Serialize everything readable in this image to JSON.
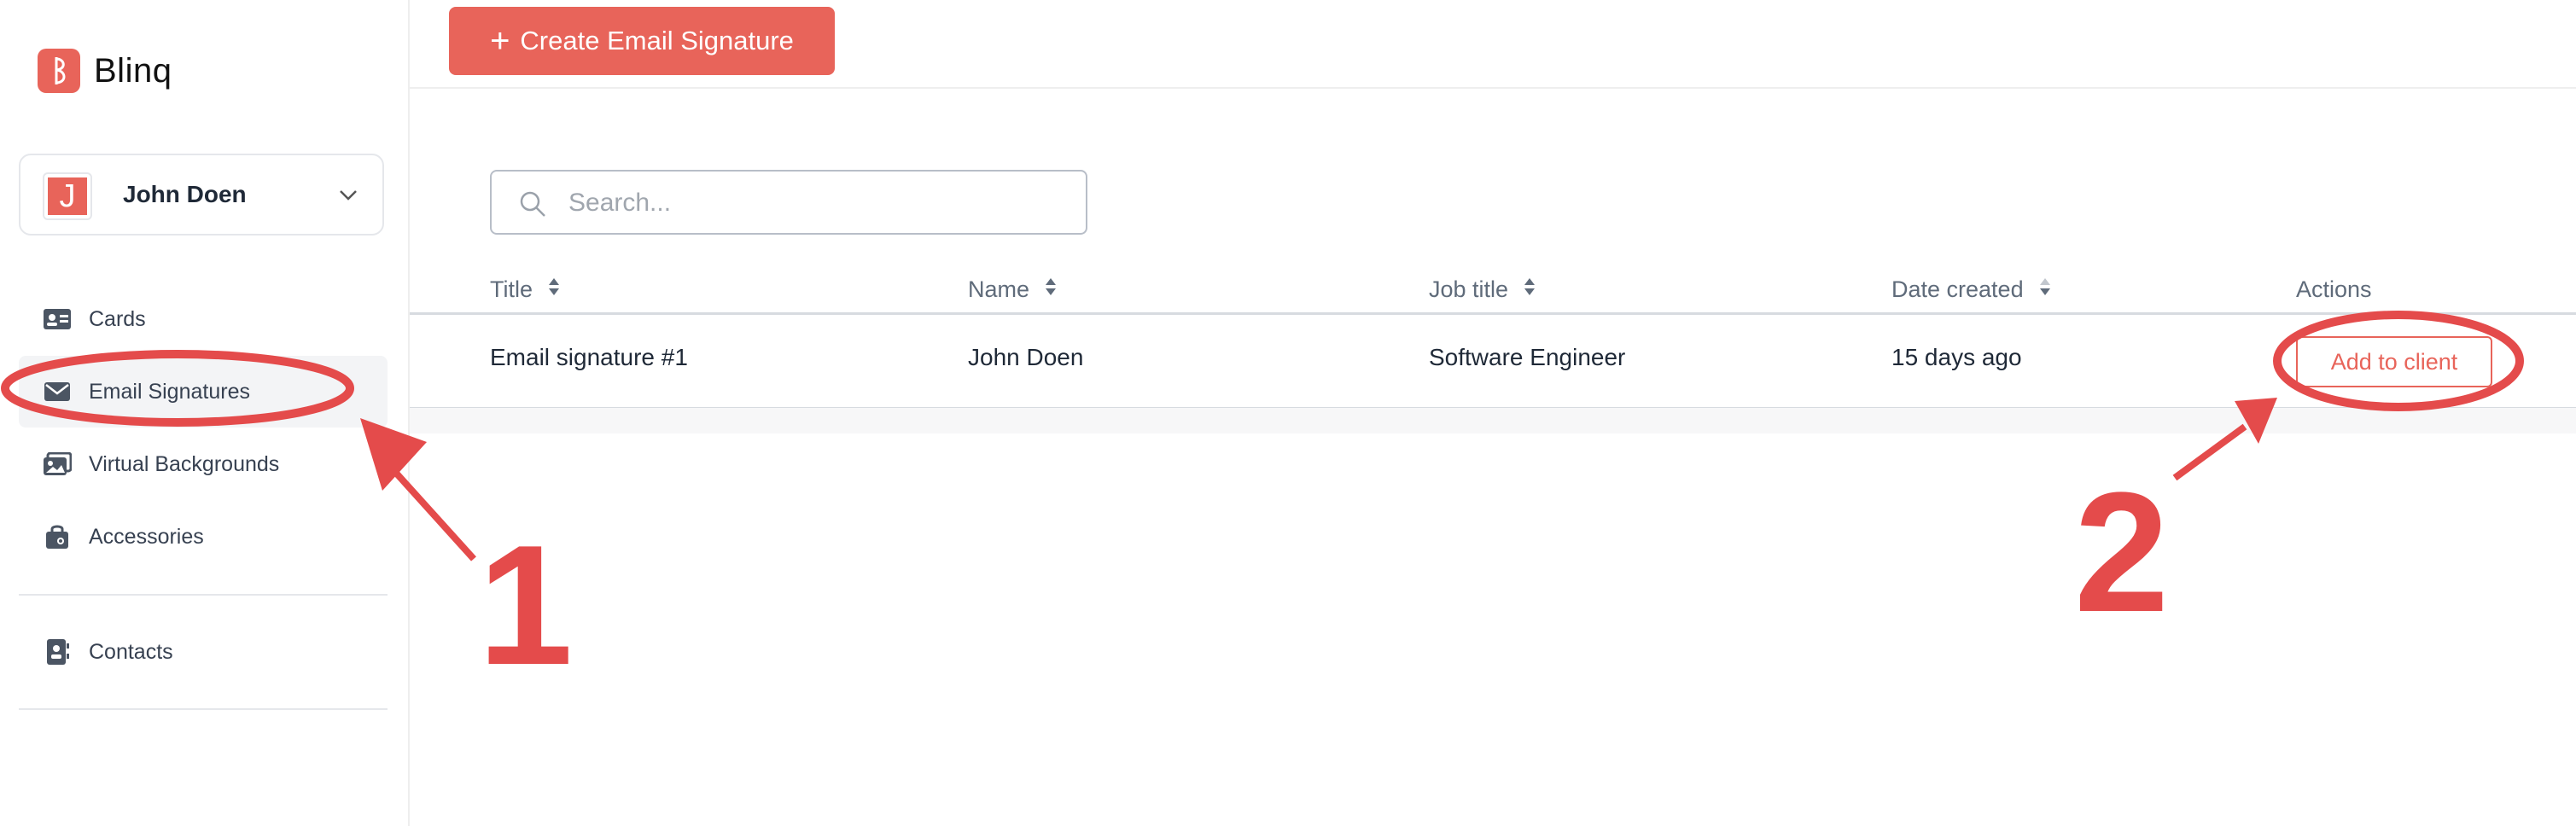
{
  "app": {
    "name": "Blinq"
  },
  "account": {
    "initial": "J",
    "name": "John Doen"
  },
  "sidebar": {
    "items": [
      {
        "label": "Cards",
        "icon": "id-card-icon"
      },
      {
        "label": "Email Signatures",
        "icon": "envelope-icon",
        "active": true
      },
      {
        "label": "Virtual Backgrounds",
        "icon": "images-icon"
      },
      {
        "label": "Accessories",
        "icon": "shopping-bag-icon"
      },
      {
        "label": "Contacts",
        "icon": "contact-book-icon"
      }
    ]
  },
  "toolbar": {
    "create_label": "Create Email Signature"
  },
  "search": {
    "placeholder": "Search..."
  },
  "table": {
    "columns": [
      "Title",
      "Name",
      "Job title",
      "Date created",
      "Actions"
    ],
    "rows": [
      {
        "title": "Email signature #1",
        "name": "John Doen",
        "job_title": "Software Engineer",
        "date_created": "15 days ago",
        "action_label": "Add to client"
      }
    ]
  },
  "annotations": {
    "step1": "1",
    "step2": "2"
  },
  "colors": {
    "accent": "#e8645a",
    "annotation": "#e44b4b"
  }
}
